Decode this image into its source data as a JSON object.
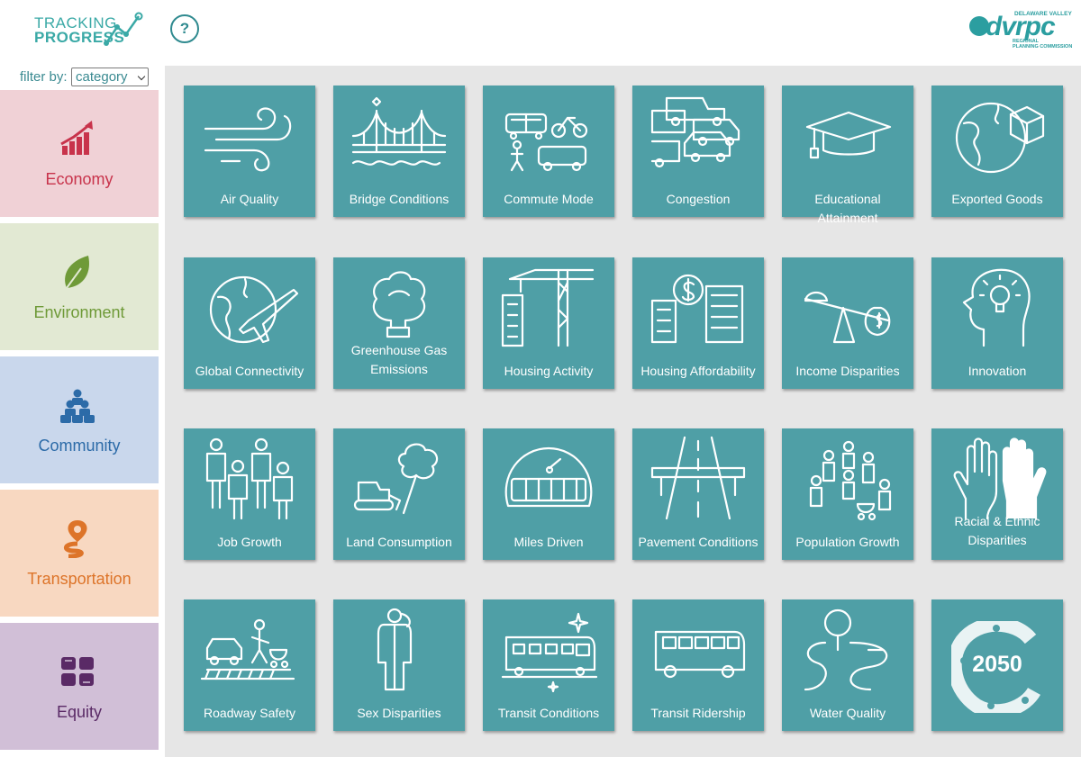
{
  "header": {
    "brand_line1": "TRACKING",
    "brand_line2": "PROGRESS",
    "help_label": "?",
    "org": {
      "name": "dvrpc",
      "top_line": "DELAWARE VALLEY",
      "sub_line1": "REGIONAL",
      "sub_line2": "PLANNING COMMISSION"
    }
  },
  "filter": {
    "label": "filter by:",
    "selected": "category"
  },
  "categories": [
    {
      "label": "Economy",
      "icon": "chart-arrow-icon",
      "bg": "#f0d1d6",
      "fg": "#c8334b"
    },
    {
      "label": "Environment",
      "icon": "leaf-icon",
      "bg": "#e2e9d3",
      "fg": "#6f9a38"
    },
    {
      "label": "Community",
      "icon": "people-pyramid-icon",
      "bg": "#c9d7ec",
      "fg": "#2c6ba8"
    },
    {
      "label": "Transportation",
      "icon": "location-route-icon",
      "bg": "#f8d8c1",
      "fg": "#dd7429"
    },
    {
      "label": "Equity",
      "icon": "joined-hands-icon",
      "bg": "#d1bfd7",
      "fg": "#5a2a66"
    }
  ],
  "tiles": [
    {
      "label": "Air Quality",
      "icon": "wind-icon"
    },
    {
      "label": "Bridge Conditions",
      "icon": "bridge-icon"
    },
    {
      "label": "Commute Mode",
      "icon": "commute-icon"
    },
    {
      "label": "Congestion",
      "icon": "traffic-cars-icon"
    },
    {
      "label": "Educational Attainment",
      "icon": "graduation-cap-icon"
    },
    {
      "label": "Exported Goods",
      "icon": "globe-box-icon"
    },
    {
      "label": "Global Connectivity",
      "icon": "globe-plane-icon"
    },
    {
      "label": "Greenhouse Gas Emissions",
      "icon": "smokestack-icon"
    },
    {
      "label": "Housing Activity",
      "icon": "crane-icon"
    },
    {
      "label": "Housing Affordability",
      "icon": "dollar-buildings-icon"
    },
    {
      "label": "Income Disparities",
      "icon": "seesaw-icon"
    },
    {
      "label": "Innovation",
      "icon": "head-lightbulb-icon"
    },
    {
      "label": "Job Growth",
      "icon": "workers-icon"
    },
    {
      "label": "Land Consumption",
      "icon": "bulldozer-tree-icon"
    },
    {
      "label": "Miles Driven",
      "icon": "odometer-icon"
    },
    {
      "label": "Pavement Conditions",
      "icon": "highway-icon"
    },
    {
      "label": "Population Growth",
      "icon": "family-icon"
    },
    {
      "label": "Racial & Ethnic Disparities",
      "icon": "raised-hands-icon"
    },
    {
      "label": "Roadway Safety",
      "icon": "crosswalk-icon"
    },
    {
      "label": "Sex Disparities",
      "icon": "gender-icon"
    },
    {
      "label": "Transit Conditions",
      "icon": "train-sparkle-icon"
    },
    {
      "label": "Transit Ridership",
      "icon": "bus-icon"
    },
    {
      "label": "Water Quality",
      "icon": "river-tree-icon"
    },
    {
      "label": "",
      "icon": "year-2050-badge-icon",
      "badge_text": "2050"
    }
  ]
}
